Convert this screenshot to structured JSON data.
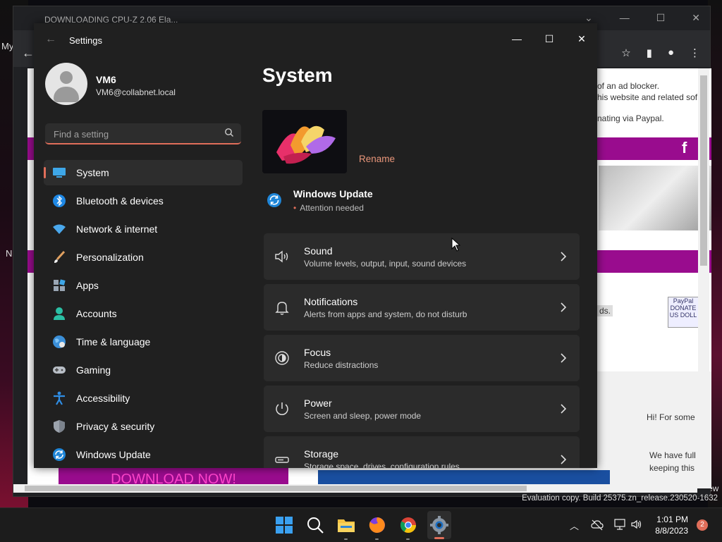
{
  "desktop": {
    "left_text_1": "My",
    "left_text_2": "N",
    "right_text": "ew"
  },
  "browser": {
    "tab_title": "DOWNLOADING CPU-Z 2.06 Ela...",
    "web": {
      "line1": "of an ad blocker.",
      "line2": "his website and related sof",
      "line3": "nating via Paypal.",
      "fb": "f",
      "ads": "ds.",
      "paypal": "PayPal DONATE US DOLL",
      "hi_text": "Hi! For some",
      "full_text": "We have full",
      "keep_text": "keeping this",
      "download_btn": "DOWNLOAD NOW!"
    }
  },
  "eval_text": "Evaluation copy. Build 25375.zn_release.230520-1632",
  "settings": {
    "window_title": "Settings",
    "user": {
      "name": "VM6",
      "email": "VM6@collabnet.local"
    },
    "search_placeholder": "Find a setting",
    "nav": [
      {
        "label": "System",
        "icon": "monitor-icon"
      },
      {
        "label": "Bluetooth & devices",
        "icon": "bluetooth-icon"
      },
      {
        "label": "Network & internet",
        "icon": "wifi-icon"
      },
      {
        "label": "Personalization",
        "icon": "brush-icon"
      },
      {
        "label": "Apps",
        "icon": "apps-icon"
      },
      {
        "label": "Accounts",
        "icon": "person-icon"
      },
      {
        "label": "Time & language",
        "icon": "globe-icon"
      },
      {
        "label": "Gaming",
        "icon": "gamepad-icon"
      },
      {
        "label": "Accessibility",
        "icon": "accessibility-icon"
      },
      {
        "label": "Privacy & security",
        "icon": "shield-icon"
      },
      {
        "label": "Windows Update",
        "icon": "update-icon"
      }
    ],
    "page_title": "System",
    "rename_label": "Rename",
    "windows_update": {
      "title": "Windows Update",
      "status": "Attention needed"
    },
    "cards": [
      {
        "title": "Sound",
        "subtitle": "Volume levels, output, input, sound devices",
        "icon": "speaker-icon"
      },
      {
        "title": "Notifications",
        "subtitle": "Alerts from apps and system, do not disturb",
        "icon": "bell-icon"
      },
      {
        "title": "Focus",
        "subtitle": "Reduce distractions",
        "icon": "focus-icon"
      },
      {
        "title": "Power",
        "subtitle": "Screen and sleep, power mode",
        "icon": "power-icon"
      },
      {
        "title": "Storage",
        "subtitle": "Storage space, drives, configuration rules",
        "icon": "storage-icon"
      }
    ]
  },
  "taskbar": {
    "time": "1:01 PM",
    "date": "8/8/2023",
    "notification_count": "2"
  },
  "colors": {
    "accent": "#e06e5a",
    "window_bg": "#202020",
    "card_bg": "#2b2b2b",
    "web_purple": "#990c8e"
  }
}
